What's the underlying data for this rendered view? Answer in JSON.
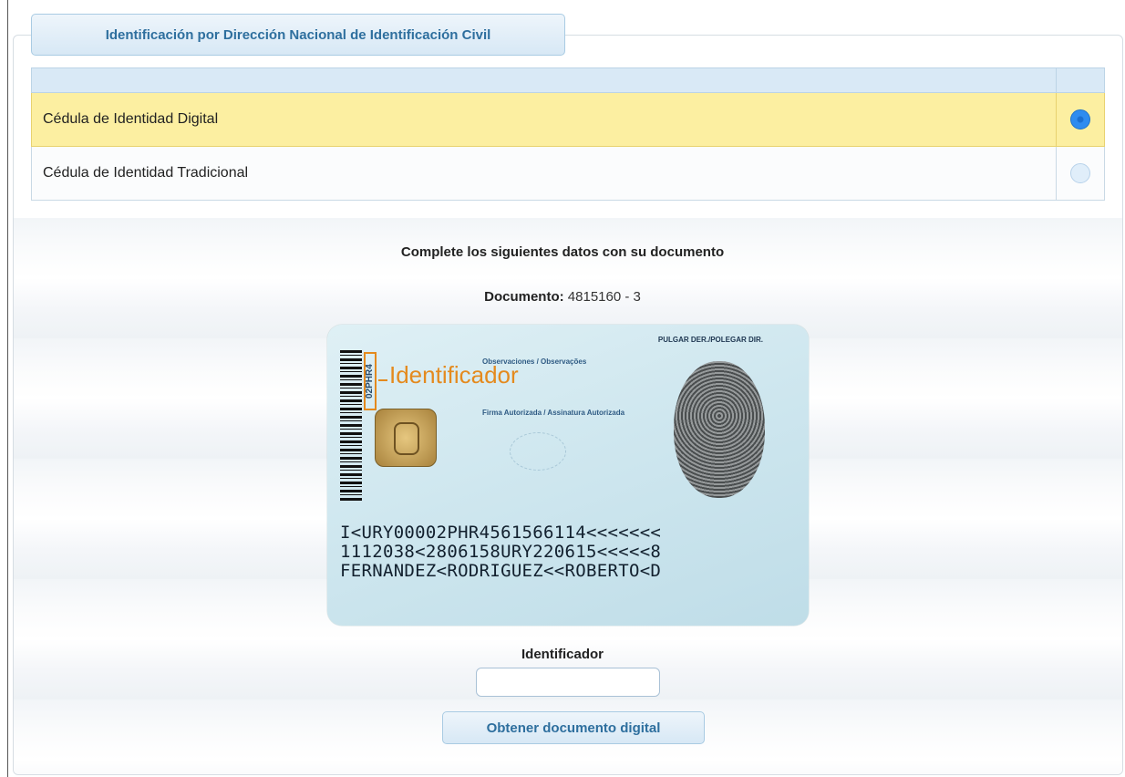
{
  "section_title": "Identificación por Dirección Nacional de Identificación Civil",
  "options": [
    {
      "label": "Cédula de Identidad Digital",
      "selected": true
    },
    {
      "label": "Cédula de Identidad Tradicional",
      "selected": false
    }
  ],
  "instructions": "Complete los siguientes datos con su documento",
  "document": {
    "label": "Documento:",
    "value": "4815160 - 3"
  },
  "card": {
    "tag_code": "02PHR4",
    "identifier_label": "Identificador",
    "observaciones": "Observaciones / Observações",
    "firma": "Firma Autorizada / Assinatura Autorizada",
    "pulgar": "PULGAR DER./POLEGAR DIR.",
    "mrz": [
      "I<URY00002PHR4561566114<<<<<<<",
      "1112038<2806158URY220615<<<<<8",
      "FERNANDEZ<RODRIGUEZ<<ROBERTO<D"
    ]
  },
  "identifier_field": {
    "label": "Identificador",
    "value": ""
  },
  "submit_label": "Obtener documento digital",
  "colors": {
    "accent": "#2e6f9e",
    "selected_row": "#fcefa1",
    "header_row": "#d9e9f6"
  }
}
